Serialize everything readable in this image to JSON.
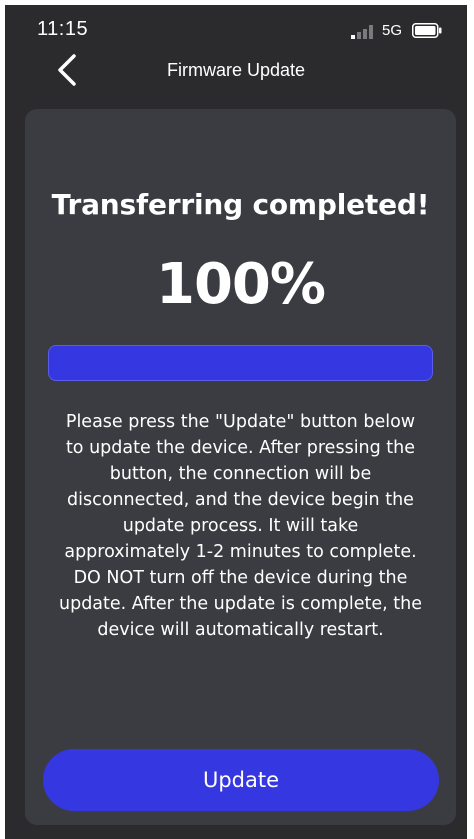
{
  "status_bar": {
    "time": "11:15",
    "network": "5G",
    "signal_icon": "signal-bars-icon",
    "battery_icon": "battery-icon"
  },
  "nav": {
    "back_icon": "chevron-left-icon",
    "title": "Firmware Update"
  },
  "card": {
    "title": "Transferring completed!",
    "percent_label": "100%",
    "progress": 1.0,
    "instructions": "Please press the \"Update\" button below to update the device. After pressing the button, the connection will be disconnected, and the device begin the update process. It will take approximately 1-2 minutes to complete. DO NOT turn off the device during the update. After the update is complete, the device will automatically restart."
  },
  "actions": {
    "update_label": "Update"
  },
  "colors": {
    "background": "#2b2b2d",
    "card": "#3b3b42",
    "accent": "#3538e0",
    "text": "#ffffff"
  }
}
